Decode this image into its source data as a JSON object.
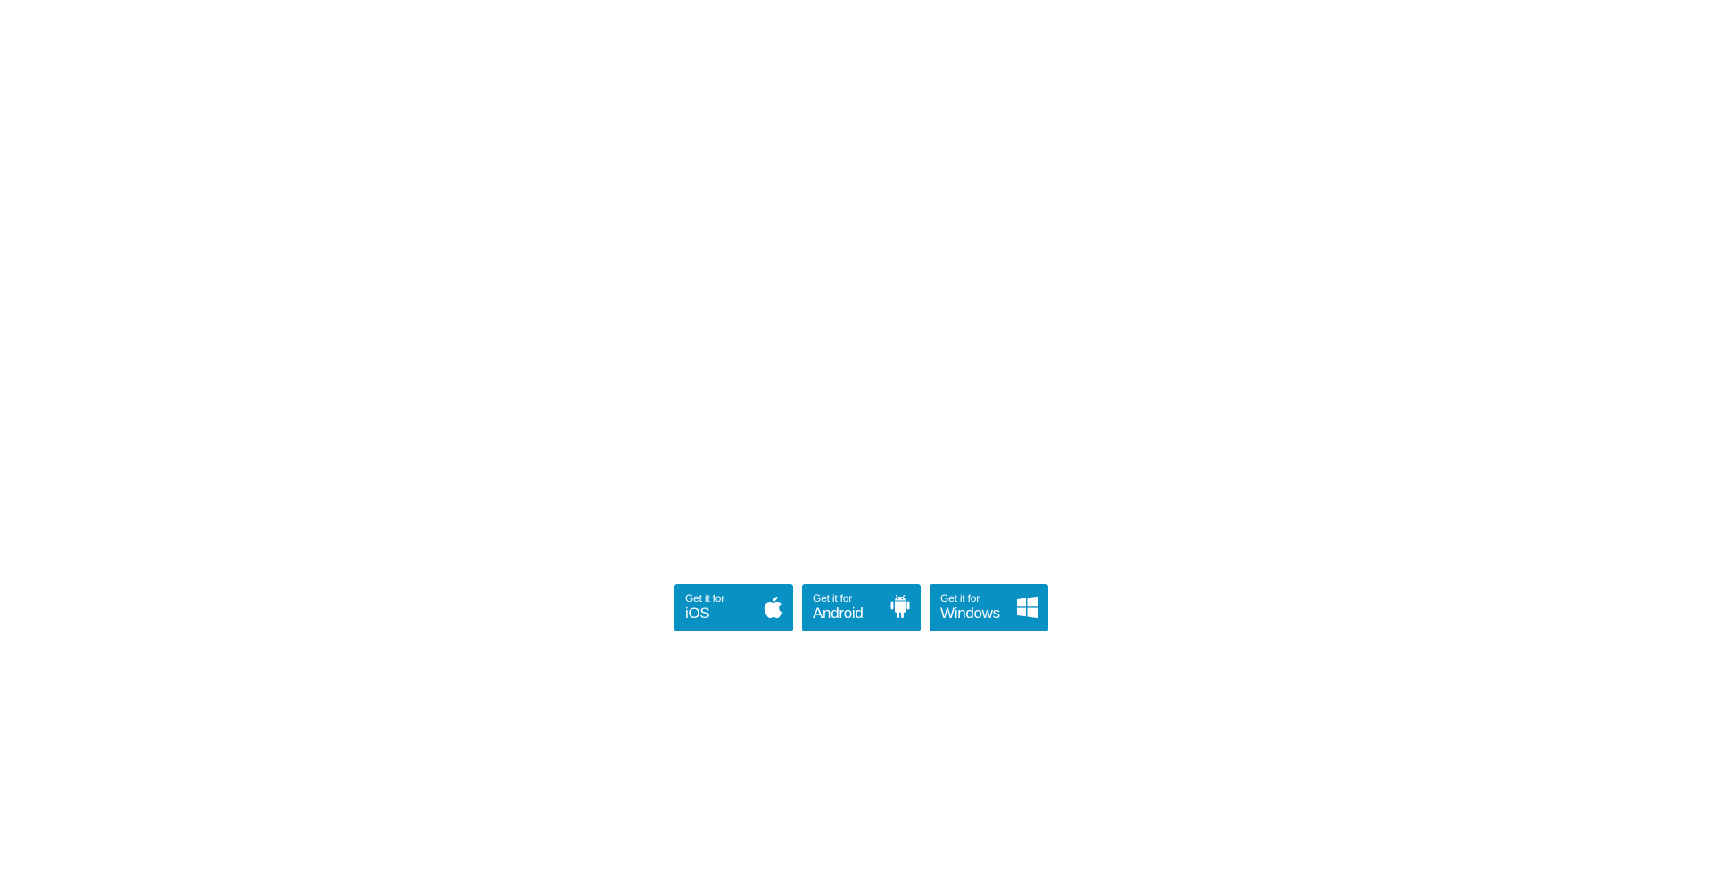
{
  "colors": {
    "background": "#ffffff",
    "button_bg": "#0a91c4",
    "button_text": "#ffffff"
  },
  "store_buttons": [
    {
      "prefix": "Get it for",
      "platform": "iOS",
      "icon": "apple-icon"
    },
    {
      "prefix": "Get it for",
      "platform": "Android",
      "icon": "android-icon"
    },
    {
      "prefix": "Get it for",
      "platform": "Windows",
      "icon": "windows-icon"
    }
  ]
}
